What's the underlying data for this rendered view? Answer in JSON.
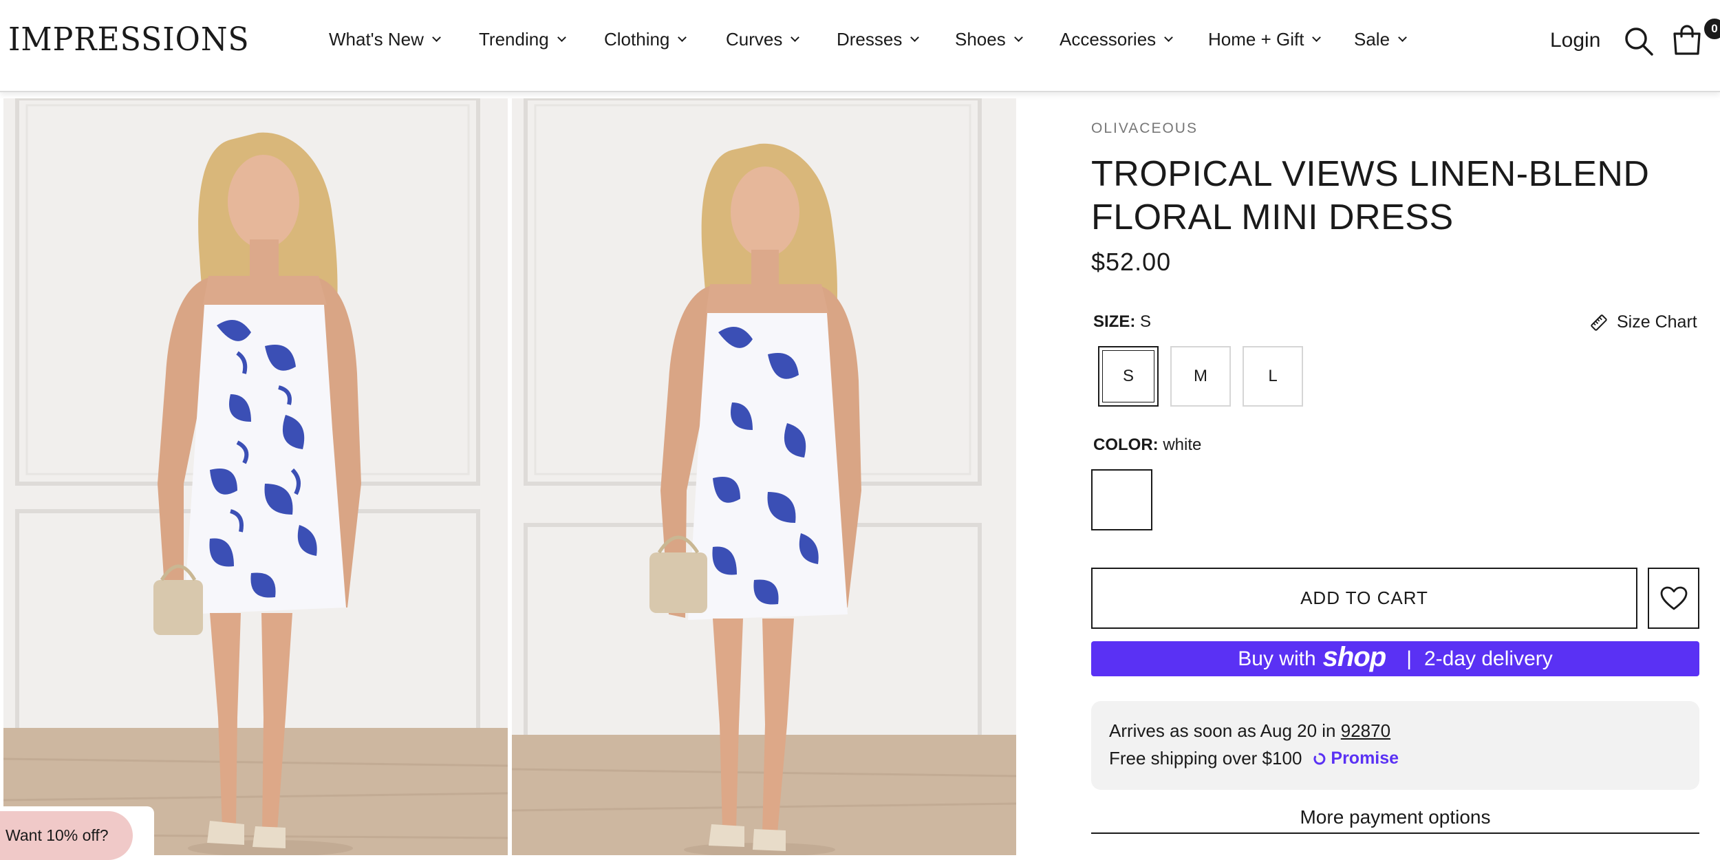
{
  "brand": {
    "logo_text": "IMPRESSIONS"
  },
  "nav": {
    "items": [
      {
        "label": "What's New"
      },
      {
        "label": "Trending"
      },
      {
        "label": "Clothing"
      },
      {
        "label": "Curves"
      },
      {
        "label": "Dresses"
      },
      {
        "label": "Shoes"
      },
      {
        "label": "Accessories"
      },
      {
        "label": "Home + Gift"
      },
      {
        "label": "Sale"
      }
    ],
    "chevron_icon": "chevron-down-icon"
  },
  "header_actions": {
    "login_label": "Login",
    "search_icon": "search-icon",
    "cart_icon": "shopping-bag-icon",
    "cart_count": "0"
  },
  "gallery": {
    "images": [
      {
        "name": "product-photo-front"
      },
      {
        "name": "product-photo-angle"
      }
    ]
  },
  "product": {
    "vendor": "OLIVACEOUS",
    "title": "TROPICAL VIEWS LINEN-BLEND FLORAL MINI DRESS",
    "price": "$52.00",
    "size": {
      "label": "SIZE:",
      "selected": "S",
      "options": [
        "S",
        "M",
        "L"
      ],
      "size_chart_label": "Size Chart",
      "size_chart_icon": "ruler-icon"
    },
    "color": {
      "label": "COLOR:",
      "selected": "white",
      "swatch_color": "#ffffff"
    },
    "add_to_cart_label": "ADD TO CART",
    "wishlist_icon": "heart-icon"
  },
  "shop_pay": {
    "prefix": "Buy with",
    "brand": "shop",
    "separator": "|",
    "suffix": "2-day delivery",
    "color": "#5a31f4"
  },
  "delivery": {
    "arrives_text": "Arrives as soon as Aug 20 in",
    "zip": "92870",
    "free_shipping_text": "Free shipping over $100",
    "promise_label": "Promise",
    "promise_color": "#5a31f4"
  },
  "more_payment_label": "More payment options",
  "promo": {
    "label": "Want 10% off?",
    "color": "#f0c9c8"
  }
}
